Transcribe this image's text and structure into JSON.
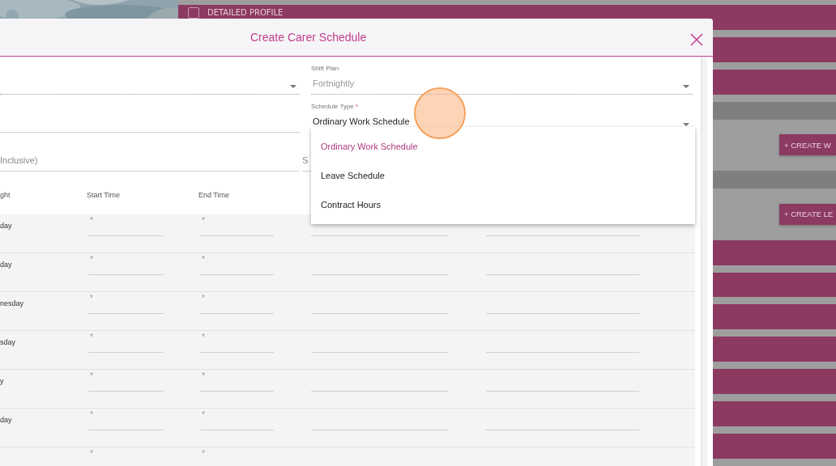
{
  "background": {
    "items": [
      {
        "kind": "bar",
        "label": "DETAILED PROFILE"
      },
      {
        "kind": "bar"
      },
      {
        "kind": "bar"
      },
      {
        "kind": "band"
      },
      {
        "kind": "action",
        "label": "+ CREATE W"
      },
      {
        "kind": "band"
      },
      {
        "kind": "action",
        "label": "+ CREATE LE"
      },
      {
        "kind": "bar"
      },
      {
        "kind": "bar"
      },
      {
        "kind": "bar"
      },
      {
        "kind": "bar"
      },
      {
        "kind": "bar"
      },
      {
        "kind": "bar"
      },
      {
        "kind": "bar"
      }
    ]
  },
  "dialog": {
    "title": "Create Carer Schedule",
    "shift_plan": {
      "label": "Shift Plan",
      "value": "Fortnightly",
      "disabled": true
    },
    "schedule_type": {
      "label": "Schedule Type",
      "required": true,
      "value": "Ordinary Work Schedule",
      "options": [
        {
          "label": "Ordinary Work Schedule",
          "selected": true
        },
        {
          "label": "Leave Schedule",
          "selected": false
        },
        {
          "label": "Contract Hours",
          "selected": false
        }
      ]
    },
    "inclusive_field": {
      "placeholder": "Inclusive)"
    },
    "cut_field": {
      "label": "S"
    },
    "table": {
      "columns": [
        "ght",
        "Start Time",
        "End Time"
      ],
      "rows": [
        {
          "day": "day",
          "start": "*",
          "end": "*"
        },
        {
          "day": "day",
          "start": "*",
          "end": "*"
        },
        {
          "day": "nesday",
          "start": "*",
          "end": "*"
        },
        {
          "day": "sday",
          "start": "*",
          "end": "*"
        },
        {
          "day": "y",
          "start": "*",
          "end": "*"
        },
        {
          "day": "day",
          "start": "*",
          "end": "*"
        },
        {
          "start": "*",
          "end": "*"
        }
      ]
    }
  }
}
